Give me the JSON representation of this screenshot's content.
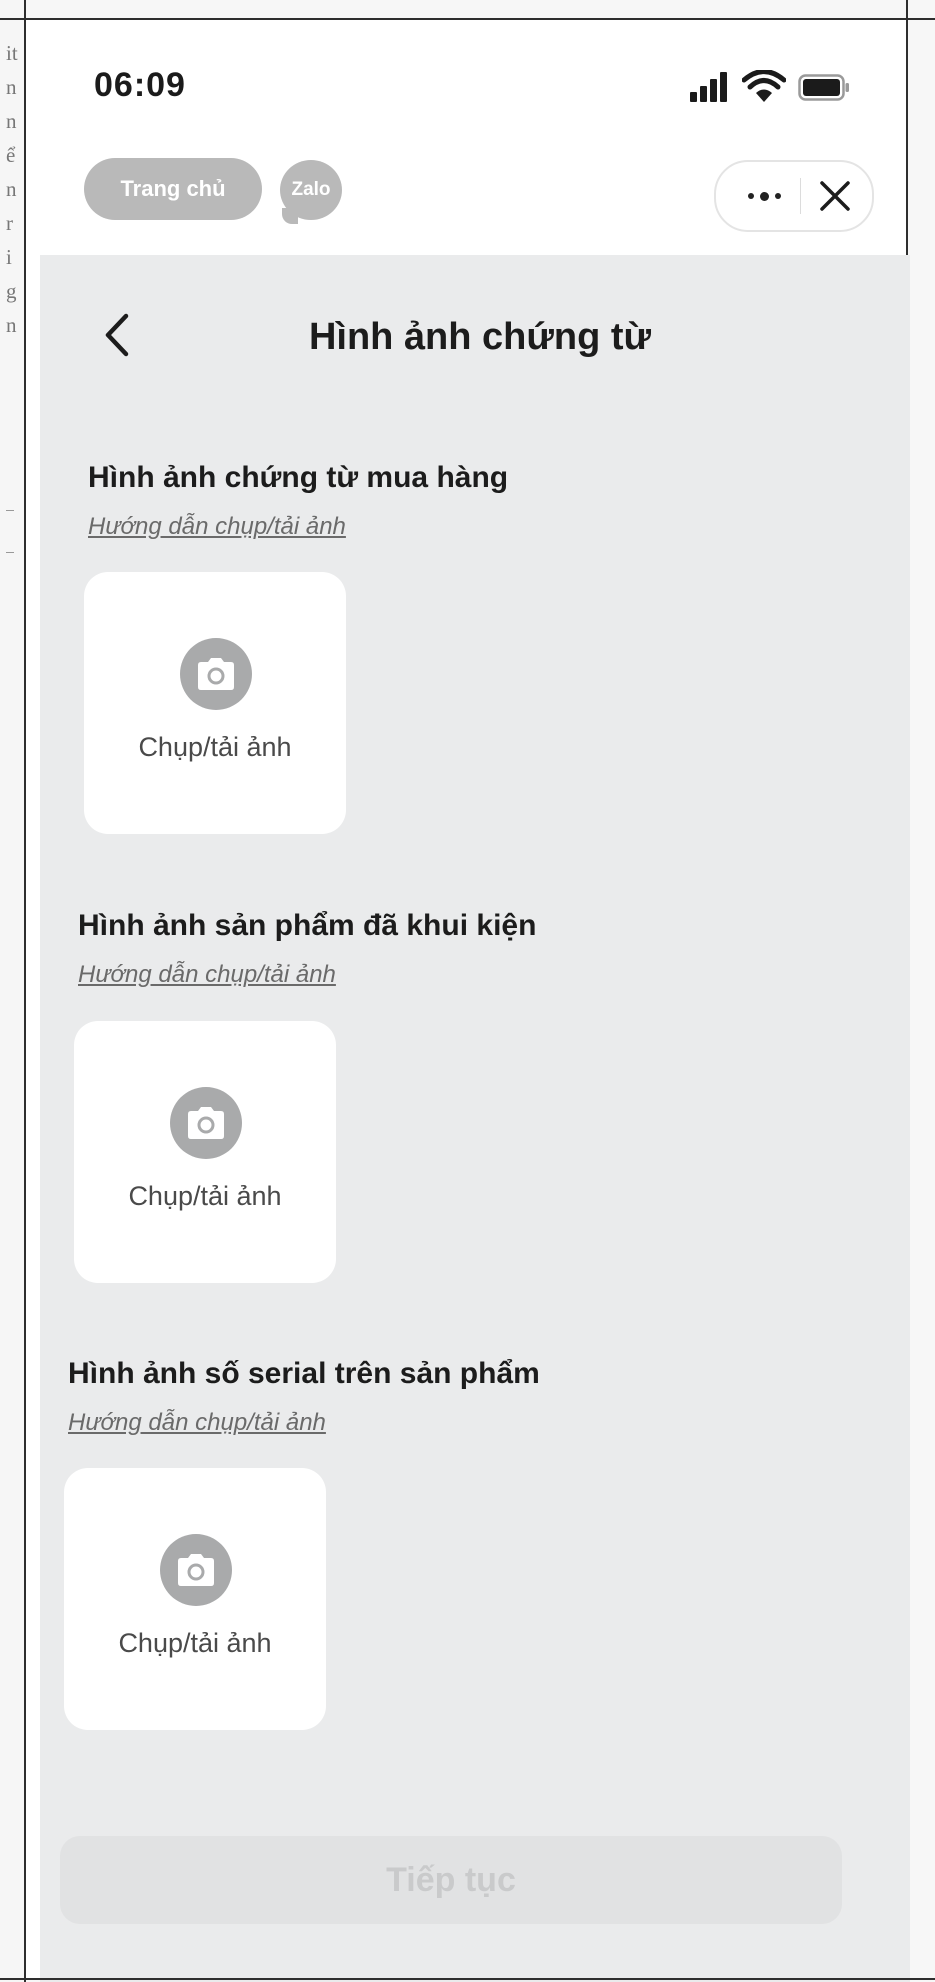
{
  "margin_letters": [
    "it",
    "n",
    "n",
    "ể",
    "n",
    "r",
    "i",
    "g",
    "n"
  ],
  "status_bar": {
    "time": "06:09",
    "signal_icon": "cellular-signal-icon",
    "wifi_icon": "wifi-icon",
    "battery_icon": "battery-icon"
  },
  "mini_app_bar": {
    "home_label": "Trang chủ",
    "brand_badge": "Zalo",
    "more_icon": "more-dots-icon",
    "close_icon": "close-icon"
  },
  "header": {
    "back_icon": "chevron-left-icon",
    "title": "Hình ảnh chứng từ"
  },
  "sections": [
    {
      "title": "Hình ảnh chứng từ mua hàng",
      "guide": "Hướng dẫn chụp/tải ảnh",
      "upload_label": "Chụp/tải ảnh",
      "icon": "camera-icon"
    },
    {
      "title": "Hình ảnh sản phẩm đã khui kiện",
      "guide": "Hướng dẫn chụp/tải ảnh",
      "upload_label": "Chụp/tải ảnh",
      "icon": "camera-icon"
    },
    {
      "title": "Hình ảnh số serial trên sản phẩm",
      "guide": "Hướng dẫn chụp/tải ảnh",
      "upload_label": "Chụp/tải ảnh",
      "icon": "camera-icon"
    }
  ],
  "footer": {
    "continue_label": "Tiếp tục"
  },
  "colors": {
    "panel_background": "#eaebec",
    "card_background": "#ffffff",
    "pill_gray": "#b9b9b9",
    "icon_gray": "#a9aaab",
    "disabled_button": "#e1e2e3",
    "disabled_text": "#c9cacb",
    "title_text": "#1c1c1c"
  }
}
